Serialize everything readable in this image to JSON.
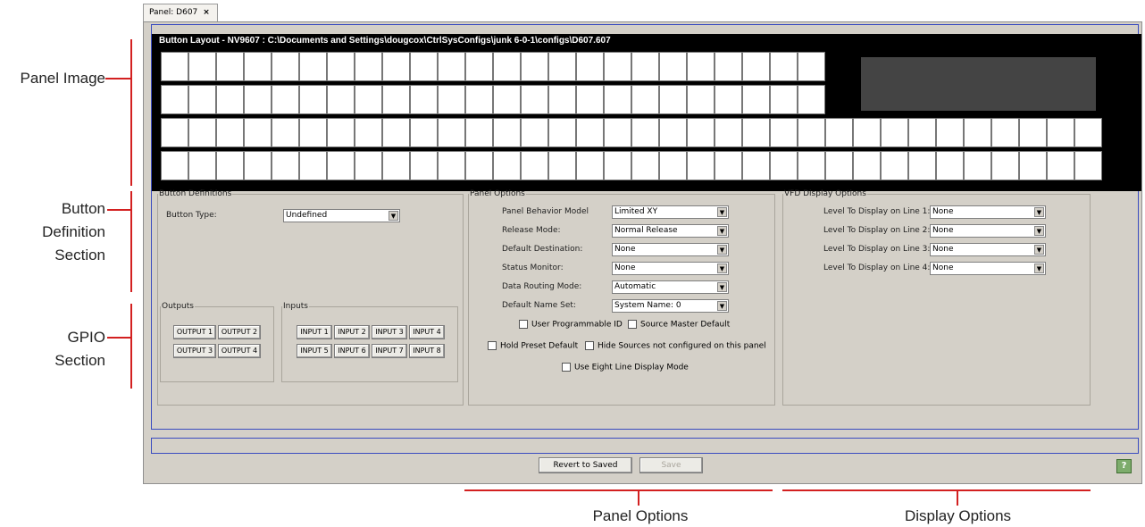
{
  "annotations": {
    "panel_image": "Panel Image",
    "button_definition_lines": [
      "Button",
      "Definition",
      "Section"
    ],
    "gpio_lines": [
      "GPIO",
      "Section"
    ],
    "panel_options": "Panel Options",
    "display_options": "Display Options"
  },
  "tab": {
    "label": "Panel: D607",
    "close": "×"
  },
  "panel_image": {
    "title": "Button Layout - NV9607 : C:\\Documents and Settings\\dougcox\\CtrlSysConfigs\\junk 6-0-1\\configs\\D607.607"
  },
  "button_definitions": {
    "legend": "Button Definitions",
    "button_type_label": "Button Type:",
    "button_type_value": "Undefined"
  },
  "outputs": {
    "legend": "Outputs",
    "buttons": [
      "OUTPUT 1",
      "OUTPUT 2",
      "OUTPUT 3",
      "OUTPUT 4"
    ]
  },
  "inputs": {
    "legend": "Inputs",
    "buttons": [
      "INPUT 1",
      "INPUT 2",
      "INPUT 3",
      "INPUT 4",
      "INPUT 5",
      "INPUT 6",
      "INPUT 7",
      "INPUT 8"
    ]
  },
  "panel_options": {
    "legend": "Panel Options",
    "rows": [
      {
        "label": "Panel Behavior Model",
        "value": "Limited XY"
      },
      {
        "label": "Release Mode:",
        "value": "Normal Release"
      },
      {
        "label": "Default Destination:",
        "value": "None"
      },
      {
        "label": "Status Monitor:",
        "value": "None"
      },
      {
        "label": "Data Routing Mode:",
        "value": "Automatic"
      },
      {
        "label": "Default Name Set:",
        "value": "System Name: 0"
      }
    ],
    "checkboxes": {
      "user_programmable_id": "User Programmable ID",
      "source_master_default": "Source Master Default",
      "hold_preset_default": "Hold Preset Default",
      "hide_sources": "Hide Sources not configured on this panel",
      "eight_line": "Use Eight Line Display Mode"
    }
  },
  "vfd_options": {
    "legend": "VFD Display Options",
    "rows": [
      {
        "label": "Level To Display on Line 1:",
        "value": "None"
      },
      {
        "label": "Level To Display on Line 2:",
        "value": "None"
      },
      {
        "label": "Level To Display on Line 3:",
        "value": "None"
      },
      {
        "label": "Level To Display on Line 4:",
        "value": "None"
      }
    ]
  },
  "footer": {
    "revert": "Revert to Saved",
    "save": "Save",
    "help": "?"
  },
  "colors": {
    "annotation_line": "#d32020",
    "frame_border": "#3a4cc0",
    "window_bg": "#d4d0c8"
  }
}
